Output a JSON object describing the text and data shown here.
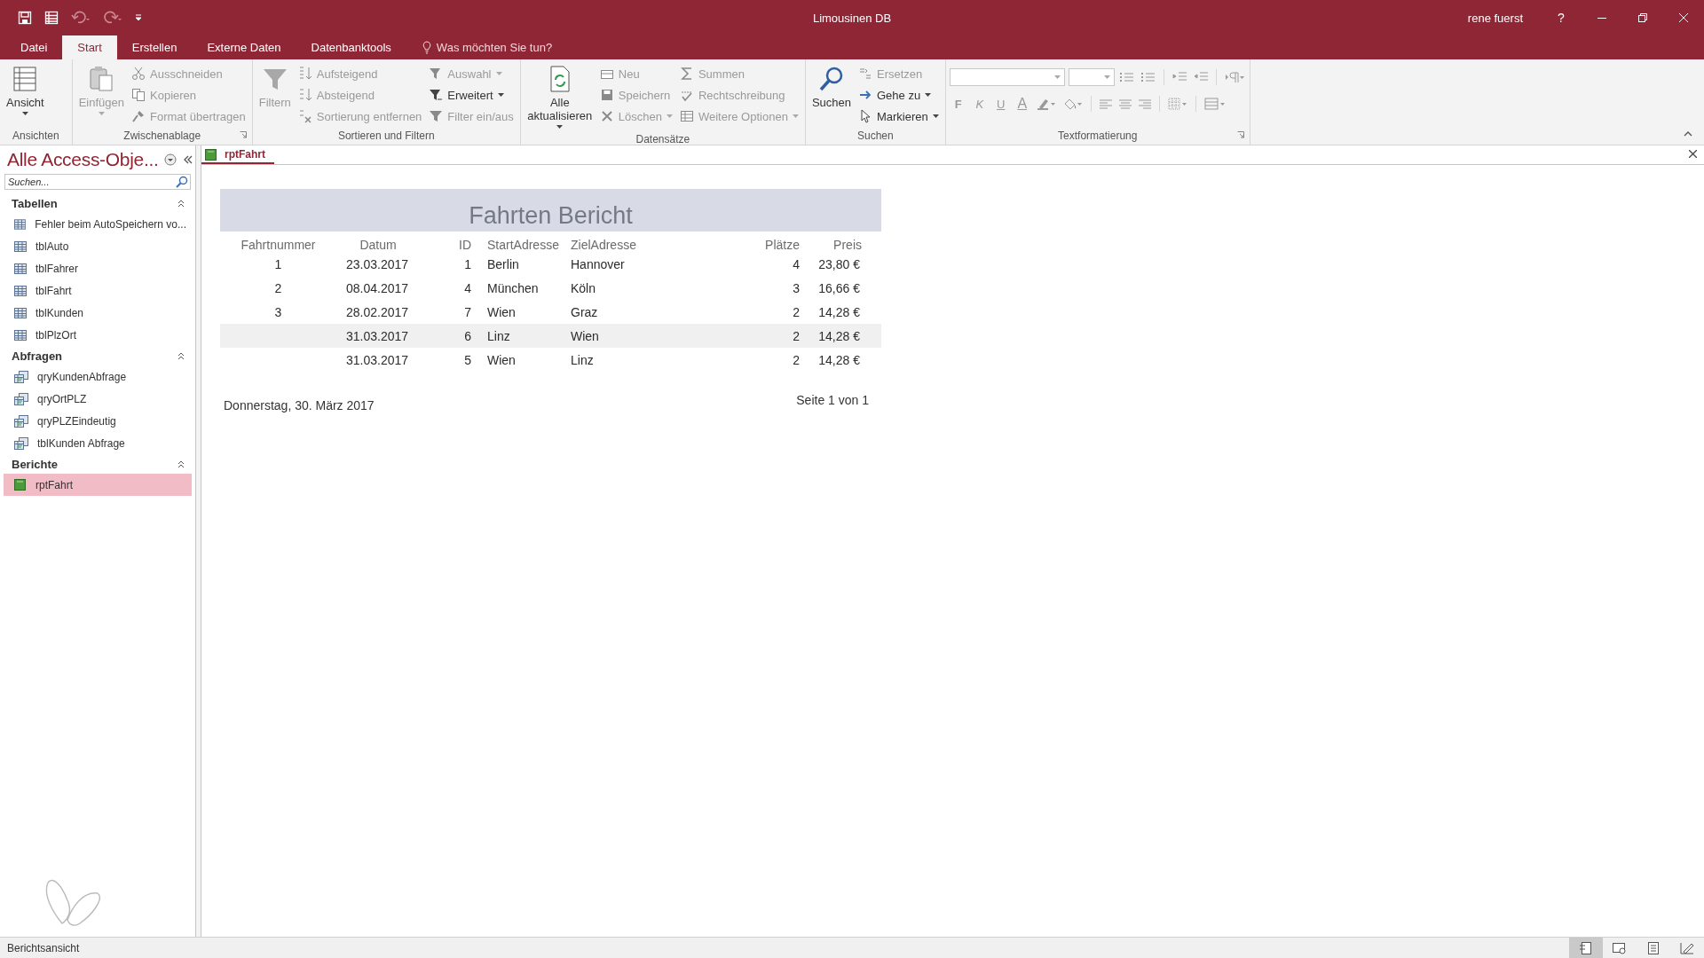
{
  "window": {
    "title": "Limousinen DB",
    "user": "rene fuerst",
    "help": "?"
  },
  "tabs": [
    {
      "label": "Datei",
      "selected": false
    },
    {
      "label": "Start",
      "selected": true
    },
    {
      "label": "Erstellen",
      "selected": false
    },
    {
      "label": "Externe Daten",
      "selected": false
    },
    {
      "label": "Datenbanktools",
      "selected": false
    }
  ],
  "tell_me": "Was möchten Sie tun?",
  "ribbon": {
    "groups": [
      {
        "label": "Ansichten",
        "kind": "buttons",
        "launcher": false,
        "columns": [
          [
            {
              "label": "Ansicht",
              "kind": "large",
              "disabled": false,
              "menu": true
            }
          ]
        ]
      },
      {
        "label": "Zwischenablage",
        "kind": "buttons",
        "launcher": true,
        "columns": [
          [
            {
              "label": "Einfügen",
              "kind": "large",
              "disabled": true,
              "menu": true
            }
          ],
          [
            {
              "label": "Ausschneiden",
              "kind": "small",
              "disabled": true,
              "menu": false
            },
            {
              "label": "Kopieren",
              "kind": "small",
              "disabled": true,
              "menu": false
            },
            {
              "label": "Format übertragen",
              "kind": "small",
              "disabled": true,
              "menu": false
            }
          ]
        ]
      },
      {
        "label": "Sortieren und Filtern",
        "kind": "buttons",
        "launcher": false,
        "columns": [
          [
            {
              "label": "Filtern",
              "kind": "large",
              "disabled": true,
              "menu": false
            }
          ],
          [
            {
              "label": "Aufsteigend",
              "kind": "small",
              "disabled": true,
              "menu": false
            },
            {
              "label": "Absteigend",
              "kind": "small",
              "disabled": true,
              "menu": false
            },
            {
              "label": "Sortierung entfernen",
              "kind": "small",
              "disabled": true,
              "menu": false
            }
          ],
          [
            {
              "label": "Auswahl",
              "kind": "small",
              "disabled": true,
              "menu": true
            },
            {
              "label": "Erweitert",
              "kind": "small",
              "disabled": false,
              "menu": true
            },
            {
              "label": "Filter ein/aus",
              "kind": "small",
              "disabled": true,
              "menu": false
            }
          ]
        ]
      },
      {
        "label": "Datensätze",
        "kind": "buttons",
        "launcher": false,
        "columns": [
          [
            {
              "label": "Alle aktualisieren",
              "kind": "large",
              "disabled": false,
              "menu": true
            }
          ],
          [
            {
              "label": "Neu",
              "kind": "small",
              "disabled": true,
              "menu": false
            },
            {
              "label": "Speichern",
              "kind": "small",
              "disabled": true,
              "menu": false
            },
            {
              "label": "Löschen",
              "kind": "small",
              "disabled": true,
              "menu": true
            }
          ],
          [
            {
              "label": "Summen",
              "kind": "small",
              "disabled": true,
              "menu": false
            },
            {
              "label": "Rechtschreibung",
              "kind": "small",
              "disabled": true,
              "menu": false
            },
            {
              "label": "Weitere Optionen",
              "kind": "small",
              "disabled": true,
              "menu": true
            }
          ]
        ]
      },
      {
        "label": "Suchen",
        "kind": "buttons",
        "launcher": false,
        "columns": [
          [
            {
              "label": "Suchen",
              "kind": "large",
              "disabled": false,
              "menu": false
            }
          ],
          [
            {
              "label": "Ersetzen",
              "kind": "small",
              "disabled": true,
              "menu": false
            },
            {
              "label": "Gehe zu",
              "kind": "small",
              "disabled": false,
              "menu": true
            },
            {
              "label": "Markieren",
              "kind": "small",
              "disabled": false,
              "menu": true
            }
          ]
        ]
      },
      {
        "label": "Textformatierung",
        "kind": "format",
        "launcher": true,
        "bold": "F",
        "italic": "K",
        "underline": "U",
        "font_color": "A"
      }
    ]
  },
  "navigation": {
    "title": "Alle Access-Obje...",
    "search": {
      "placeholder": "Suchen..."
    },
    "sections": [
      {
        "label": "Tabellen",
        "expanded": true,
        "items": [
          {
            "label": "Fehler beim AutoSpeichern vo...",
            "kind": "table",
            "selected": false
          },
          {
            "label": "tblAuto",
            "kind": "table",
            "selected": false
          },
          {
            "label": "tblFahrer",
            "kind": "table",
            "selected": false
          },
          {
            "label": "tblFahrt",
            "kind": "table",
            "selected": false
          },
          {
            "label": "tblKunden",
            "kind": "table",
            "selected": false
          },
          {
            "label": "tblPlzOrt",
            "kind": "table",
            "selected": false
          }
        ]
      },
      {
        "label": "Abfragen",
        "expanded": true,
        "items": [
          {
            "label": "qryKundenAbfrage",
            "kind": "query",
            "selected": false
          },
          {
            "label": "qryOrtPLZ",
            "kind": "query",
            "selected": false
          },
          {
            "label": "qryPLZEindeutig",
            "kind": "query",
            "selected": false
          },
          {
            "label": "tblKunden Abfrage",
            "kind": "query",
            "selected": false
          }
        ]
      },
      {
        "label": "Berichte",
        "expanded": true,
        "items": [
          {
            "label": "rptFahrt",
            "kind": "report",
            "selected": true
          }
        ]
      }
    ]
  },
  "document": {
    "tabs": [
      {
        "label": "rptFahrt",
        "selected": true
      }
    ],
    "report": {
      "title": "Fahrten Bericht",
      "columns": [
        "Fahrtnummer",
        "Datum",
        "ID",
        "StartAdresse",
        "ZielAdresse",
        "Plätze",
        "Preis"
      ],
      "rows": [
        {
          "number": "1",
          "date": "23.03.2017",
          "id": "1",
          "start": "Berlin",
          "destination": "Hannover",
          "seats": "4",
          "price": "23,80 €",
          "highlighted": false
        },
        {
          "number": "2",
          "date": "08.04.2017",
          "id": "4",
          "start": "München",
          "destination": "Köln",
          "seats": "3",
          "price": "16,66 €",
          "highlighted": false
        },
        {
          "number": "3",
          "date": "28.02.2017",
          "id": "7",
          "start": "Wien",
          "destination": "Graz",
          "seats": "2",
          "price": "14,28 €",
          "highlighted": false
        },
        {
          "date": "31.03.2017",
          "id": "6",
          "start": "Linz",
          "destination": "Wien",
          "seats": "2",
          "price": "14,28 €",
          "highlighted": true
        },
        {
          "date": "31.03.2017",
          "id": "5",
          "start": "Wien",
          "destination": "Linz",
          "seats": "2",
          "price": "14,28 €",
          "highlighted": false
        }
      ],
      "date": "Donnerstag, 30. März 2017",
      "page": "Seite 1 von 1"
    }
  },
  "status_bar": {
    "text": "Berichtsansicht",
    "views": [
      {
        "selected": true
      },
      {
        "selected": false
      },
      {
        "selected": false
      },
      {
        "selected": false
      }
    ]
  }
}
